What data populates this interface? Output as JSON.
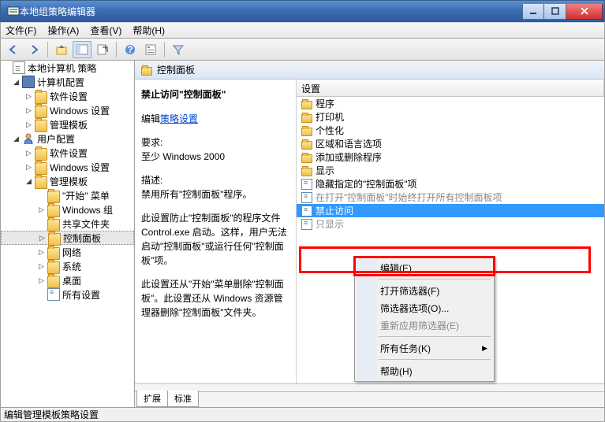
{
  "window": {
    "title": "本地组策略编辑器"
  },
  "menu": {
    "file": "文件(F)",
    "action": "操作(A)",
    "view": "查看(V)",
    "help": "帮助(H)"
  },
  "tree": {
    "root": "本地计算机 策略",
    "computer": "计算机配置",
    "c_soft": "软件设置",
    "c_win": "Windows 设置",
    "c_admin": "管理模板",
    "user": "用户配置",
    "u_soft": "软件设置",
    "u_win": "Windows 设置",
    "u_admin": "管理模板",
    "start": "\"开始\" 菜单",
    "wincomp": "Windows 组",
    "shared": "共享文件夹",
    "cpanel": "控制面板",
    "network": "网络",
    "system": "系统",
    "desktop": "桌面",
    "all": "所有设置"
  },
  "header": {
    "title": "控制面板"
  },
  "detail": {
    "title": "禁止访问\"控制面板\"",
    "edit_prefix": "编辑",
    "edit_link": "策略设置",
    "req_label": "要求:",
    "req_value": "至少 Windows 2000",
    "desc_label": "描述:",
    "desc1": "禁用所有\"控制面板\"程序。",
    "desc2": "此设置防止\"控制面板\"的程序文件 Control.exe 启动。这样，用户无法启动\"控制面板\"或运行任何\"控制面板\"项。",
    "desc3": "此设置还从\"开始\"菜单删除\"控制面板\"。此设置还从 Windows 资源管理器删除\"控制面板\"文件夹。"
  },
  "listhdr": {
    "setting": "设置"
  },
  "items": {
    "programs": "程序",
    "printers": "打印机",
    "personal": "个性化",
    "region": "区域和语言选项",
    "addremove": "添加或删除程序",
    "display": "显示",
    "hide": "隐藏指定的\"控制面板\"项",
    "dimmed": "在打开\"控制面板\"时始终打开所有控制面板项",
    "forbid": "禁止访问",
    "partial": "只显示"
  },
  "ctx": {
    "edit": "编辑(E)",
    "filter_on": "打开筛选器(F)",
    "filter_opts": "筛选器选项(O)...",
    "reapply": "重新应用筛选器(E)",
    "all_tasks": "所有任务(K)",
    "help": "帮助(H)"
  },
  "tabs": {
    "extended": "扩展",
    "standard": "标准"
  },
  "status": {
    "text": "编辑管理模板策略设置"
  }
}
